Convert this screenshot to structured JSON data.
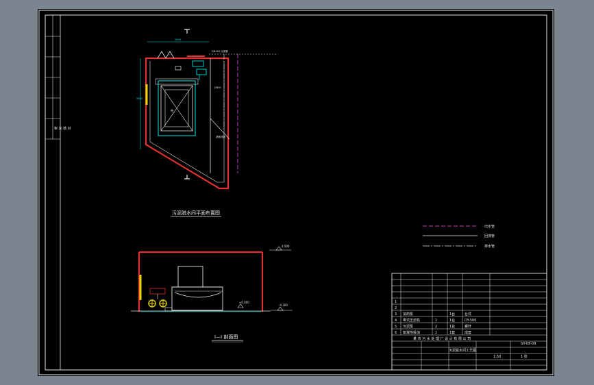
{
  "drawing": {
    "plan_title": "污泥脱水间平面布置图",
    "section_mark_top": "I",
    "section_mark_bottom": "I",
    "section_title": "I—I 剖面图",
    "dims": {
      "top_width": "3900",
      "left_depth": "5600",
      "elev_roof": "4.500",
      "elev_floor": "±0.000",
      "elev_ground": "-0.300"
    }
  },
  "legend": {
    "items": [
      {
        "label": "出水管",
        "color": "#c040c0",
        "style": "dash"
      },
      {
        "label": "回流管",
        "color": "#e8e8e8",
        "style": "solid"
      },
      {
        "label": "排水管",
        "color": "#e8e8e8",
        "style": "dashdot"
      }
    ]
  },
  "left_strip": {
    "label": "审 定 核 对"
  },
  "title_block": {
    "rows": [
      {
        "no": "1",
        "name": "",
        "qty": "",
        "unit": "",
        "note": ""
      },
      {
        "no": "2",
        "name": "",
        "qty": "",
        "unit": "",
        "note": ""
      },
      {
        "no": "3",
        "name": "加药泵",
        "qty": "",
        "unit": "1台",
        "note": "台式"
      },
      {
        "no": "4",
        "name": "带式压滤机",
        "qty": "1",
        "unit": "1台",
        "note": "DY-500"
      },
      {
        "no": "5",
        "name": "污泥泵",
        "qty": "2",
        "unit": "1台",
        "note": "螺杆"
      },
      {
        "no": "6",
        "name": "絮凝剂投加",
        "qty": "1",
        "unit": "1套",
        "note": "成套"
      }
    ],
    "company": "某 市 污 水 处 理 厂 设 计 有 限 公 司",
    "project": "污泥脱水间工艺图",
    "drawing_no": "GY-08-09",
    "scale": "1:50",
    "sheet": "1 张"
  }
}
